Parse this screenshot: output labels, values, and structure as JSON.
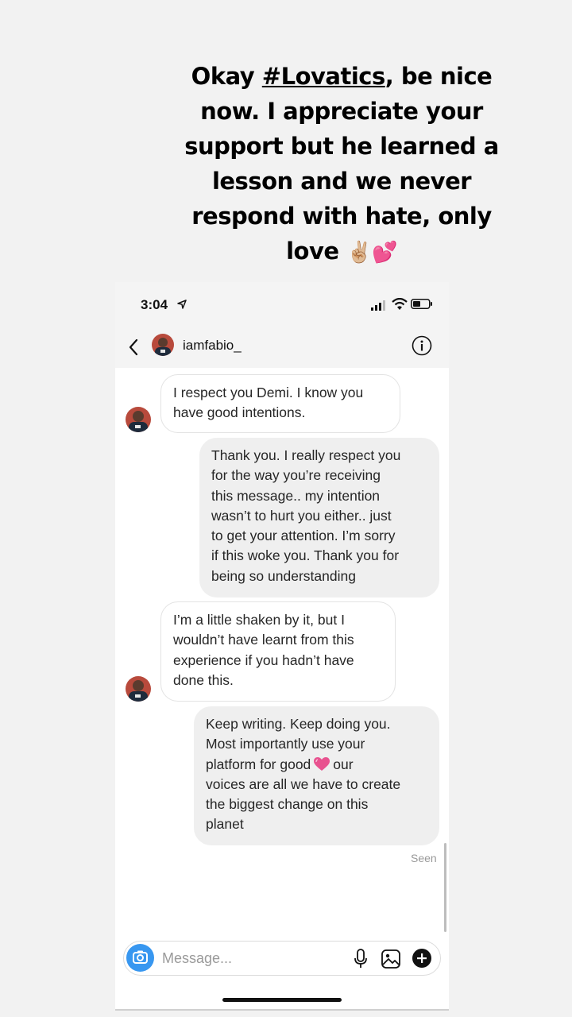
{
  "story": {
    "caption_line1_a": "Okay ",
    "hashtag": "#Lovatics",
    "caption_line1_b": ", be nice now. I appreciate your support but he learned a lesson and we never respond with hate, only love",
    "emojis": "✌🏼💕"
  },
  "status_bar": {
    "time": "3:04"
  },
  "chat": {
    "username": "iamfabio_",
    "messages": [
      {
        "from": "them",
        "text": "I respect you Demi. I know you\nhave good intentions."
      },
      {
        "from": "me",
        "text": "Thank you. I really respect you\nfor the way you’re receiving\nthis message.. my intention\nwasn’t to hurt you either.. just\nto get your attention. I’m sorry\nif this woke you. Thank you for\nbeing so understanding"
      },
      {
        "from": "them",
        "text": "I’m a little shaken by it, but I\nwouldn’t have learnt from this\nexperience if you hadn’t have\ndone this."
      },
      {
        "from": "me",
        "text_a": "Keep writing. Keep doing you.\nMost importantly use your\nplatform for good",
        "text_b": "our\nvoices are all we have to create\nthe biggest change on this\nplanet"
      }
    ],
    "seen_label": "Seen"
  },
  "composer": {
    "placeholder": "Message..."
  },
  "colors": {
    "camera_blue": "#3897f0",
    "heart_pink": "#e8528f"
  }
}
